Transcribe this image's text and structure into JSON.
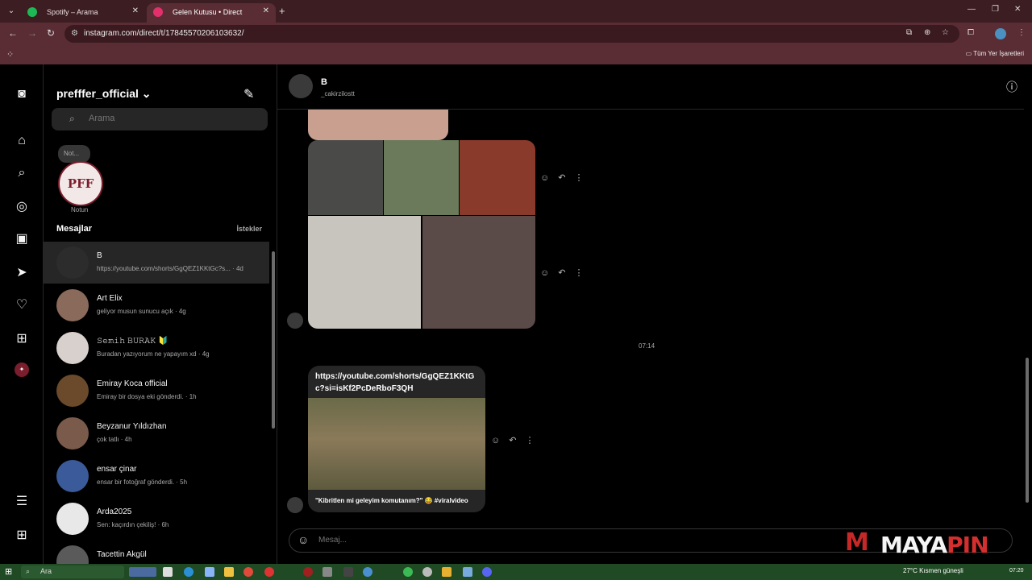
{
  "browser": {
    "tabs": [
      {
        "title": "Spotify – Arama",
        "color": "#1db954"
      },
      {
        "title": "Gelen Kutusu • Direct",
        "color": "#e1306c"
      }
    ],
    "url": "instagram.com/direct/t/17845570206103632/",
    "bookmarks_label": "Tüm Yer İşaretleri"
  },
  "inbox": {
    "username": "prefffer_official",
    "search_placeholder": "Arama",
    "note_bubble": "Not...",
    "note_label": "Notun",
    "note_logo": "PFF",
    "messages_heading": "Mesajlar",
    "requests_label": "İstekler",
    "threads": [
      {
        "name": "B",
        "preview": "https://youtube.com/shorts/GgQEZ1KKtGc?s... · 4d",
        "avatar_color": "#2c2c2c"
      },
      {
        "name": "Art Elix",
        "preview": "geliyor musun sunucu açık · 4g",
        "avatar_color": "#8a6a5a"
      },
      {
        "name": "𝚂𝚎𝚖𝚒𝚑 𝙱𝚄𝚁𝙰𝙺 🔰",
        "preview": "Buradan yazıyorum ne yapayım xd · 4g",
        "avatar_color": "#d8d0cc"
      },
      {
        "name": "Emiray Koca official",
        "preview": "Emiray bir dosya eki gönderdi. · 1h",
        "avatar_color": "#6a4a2a"
      },
      {
        "name": "Beyzanur Yıldızhan",
        "preview": "çok tatlı · 4h",
        "avatar_color": "#7a5a4a"
      },
      {
        "name": "ensar çinar",
        "preview": "ensar bir fotoğraf gönderdi. · 5h",
        "avatar_color": "#3a5a9a"
      },
      {
        "name": "Arda2025",
        "preview": "Sen: kaçırdın çekiliş! · 6h",
        "avatar_color": "#e8e8e8"
      },
      {
        "name": "Tacettin Akgül",
        "preview": "",
        "avatar_color": "#5a5a5a"
      }
    ]
  },
  "chat": {
    "name": "B",
    "handle": "_cakirzilostt",
    "timestamp": "07:14",
    "link_url": "https://youtube.com/shorts/GgQEZ1KKtGc?si=isKf2PcDeRboF3QH",
    "link_caption": "\"Kibritlen mi geleyim komutanım?\" 😂 #viralvideo",
    "composer_placeholder": "Mesaj...",
    "actions": "☺ ↶ ⋮"
  },
  "watermark": {
    "mark": "M",
    "brand_a": "MAYA",
    "brand_b": "PIN"
  },
  "taskbar": {
    "search_label": "Ara",
    "weather": "27°C  Kısmen güneşli",
    "time": "07:20"
  },
  "colors": {
    "tabbar": "#3c1d22",
    "toolbar": "#5a2d34",
    "taskbar": "#1f4a23",
    "watermark_red": "#c62828"
  }
}
